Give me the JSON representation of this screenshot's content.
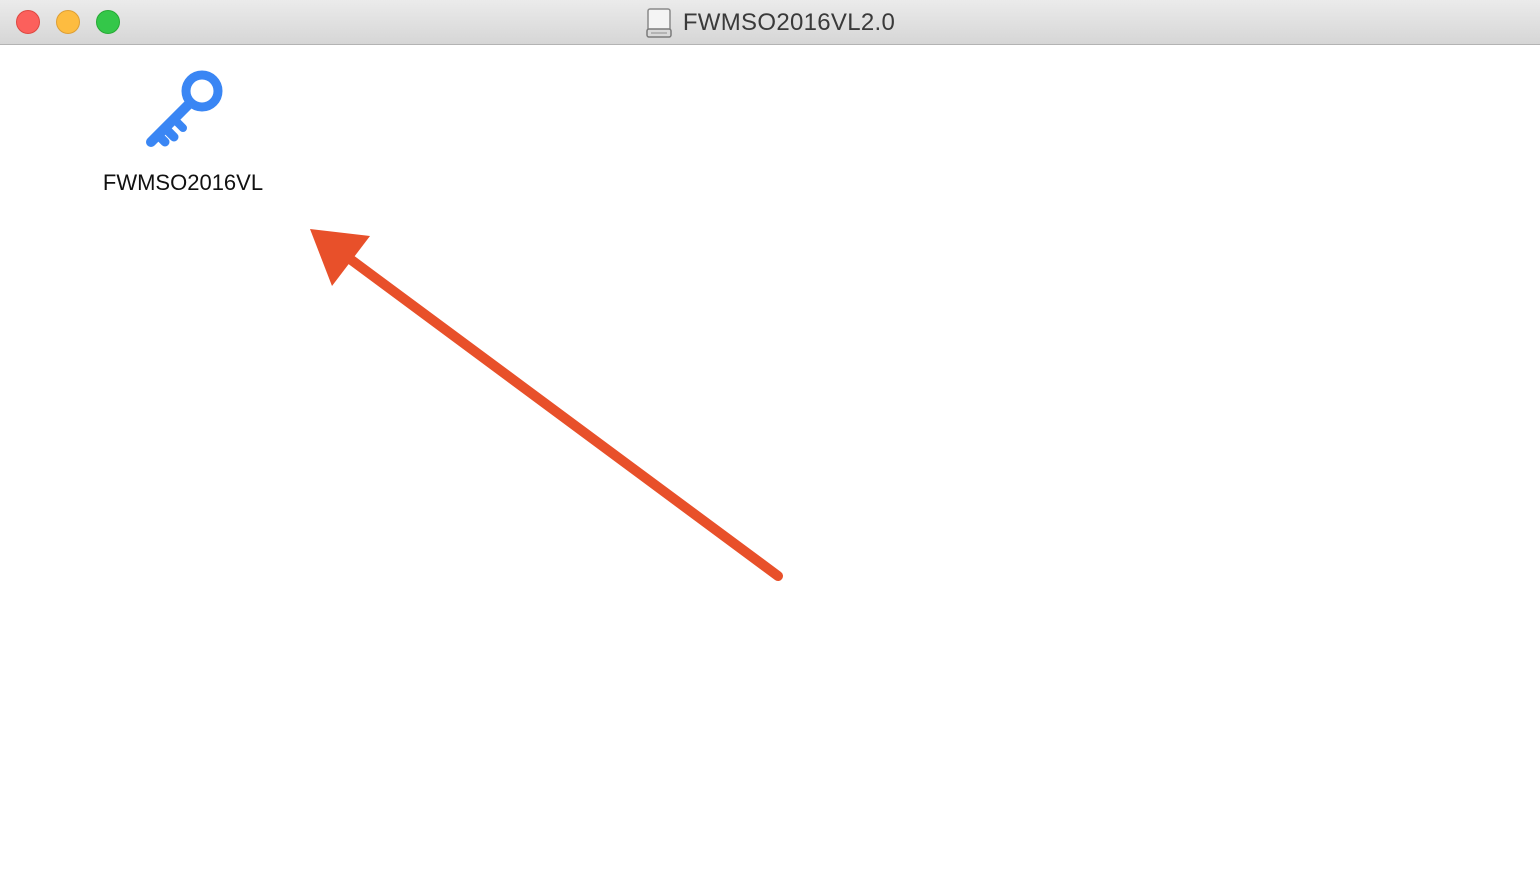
{
  "window": {
    "title": "FWMSO2016VL2.0"
  },
  "traffic_lights": {
    "close_color": "#fc605c",
    "minimize_color": "#fdbc40",
    "zoom_color": "#34c749"
  },
  "icons": {
    "title_icon": "disk-drive-icon",
    "file_icon": "key-icon"
  },
  "files": [
    {
      "name": "FWMSO2016VL"
    }
  ],
  "colors": {
    "key_icon": "#3a86f4",
    "annotation_arrow": "#e8502a"
  }
}
